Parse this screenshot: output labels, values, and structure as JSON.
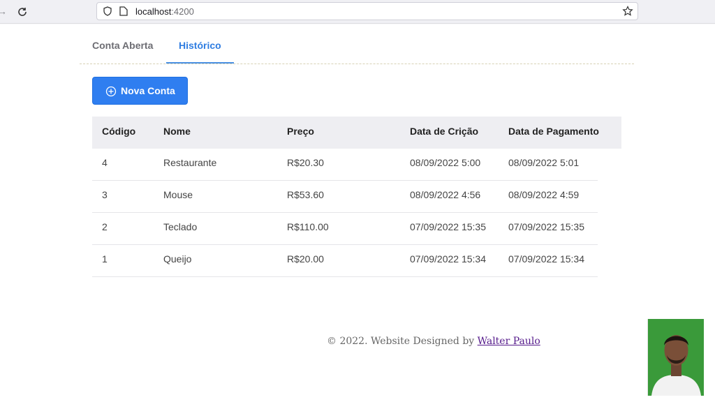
{
  "browser": {
    "url_host": "localhost",
    "url_port": ":4200"
  },
  "tabs": [
    {
      "label": "Conta Aberta",
      "active": false
    },
    {
      "label": "Histórico",
      "active": true
    }
  ],
  "actions": {
    "new_button_label": "Nova Conta"
  },
  "table": {
    "headers": [
      "Código",
      "Nome",
      "Preço",
      "Data de Crição",
      "Data de Pagamento"
    ],
    "rows": [
      [
        "4",
        "Restaurante",
        "R$20.30",
        "08/09/2022 5:00",
        "08/09/2022 5:01"
      ],
      [
        "3",
        "Mouse",
        "R$53.60",
        "08/09/2022 4:56",
        "08/09/2022 4:59"
      ],
      [
        "2",
        "Teclado",
        "R$110.00",
        "07/09/2022 15:35",
        "07/09/2022 15:35"
      ],
      [
        "1",
        "Queijo",
        "R$20.00",
        "07/09/2022 15:34",
        "07/09/2022 15:34"
      ]
    ]
  },
  "footer": {
    "text": "© 2022. Website Designed by ",
    "author_link": "Walter Paulo"
  },
  "colors": {
    "primary": "#2f7ef0",
    "active_tab": "#2f7de1"
  }
}
